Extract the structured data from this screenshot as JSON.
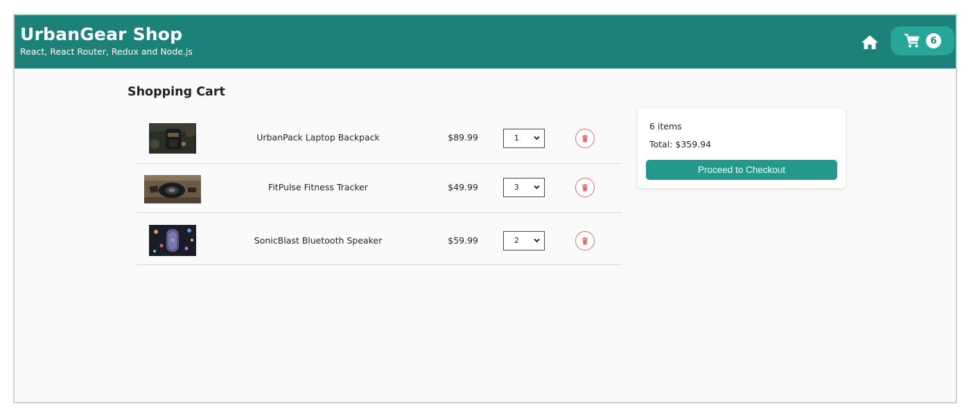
{
  "header": {
    "title": "UrbanGear Shop",
    "subtitle": "React, React Router, Redux and Node.js",
    "home_icon": "home-icon",
    "cart_icon": "cart-icon",
    "cart_count": "6",
    "color": "#1c8178",
    "cart_button_color": "#26a598"
  },
  "main": {
    "title": "Shopping Cart"
  },
  "cart": {
    "items": [
      {
        "name": "UrbanPack Laptop Backpack",
        "price": "$89.99",
        "qty": "1"
      },
      {
        "name": "FitPulse Fitness Tracker",
        "price": "$49.99",
        "qty": "3"
      },
      {
        "name": "SonicBlast Bluetooth Speaker",
        "price": "$59.99",
        "qty": "2"
      }
    ],
    "delete_icon": "trash-icon",
    "delete_color": "#e86a6a"
  },
  "summary": {
    "items_label": "6 items",
    "total_label": "Total: $359.94",
    "checkout_label": "Proceed to Checkout",
    "button_color": "#23998e"
  }
}
